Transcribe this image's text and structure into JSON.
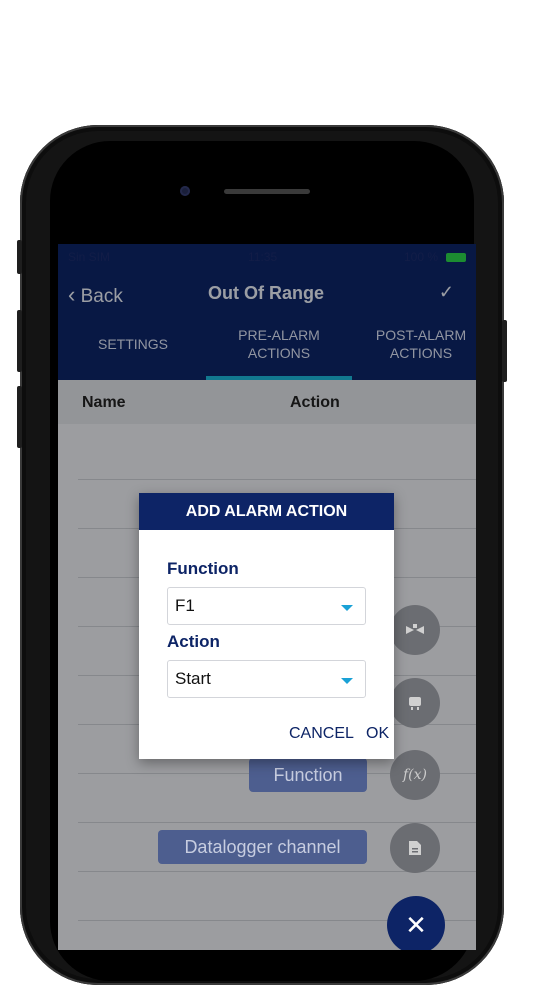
{
  "status_bar": {
    "carrier": "Sin SIM",
    "time": "11:35",
    "battery": "100 %"
  },
  "nav": {
    "back_label": "Back",
    "title": "Out Of Range",
    "confirm_icon": "✓"
  },
  "tabs": [
    {
      "label": "SETTINGS"
    },
    {
      "label": "PRE-ALARM ACTIONS",
      "active": true
    },
    {
      "label": "POST-ALARM ACTIONS"
    }
  ],
  "table": {
    "col_name": "Name",
    "col_action": "Action"
  },
  "fab_menu": {
    "items": [
      {
        "icon": "valve-icon"
      },
      {
        "icon": "device-icon"
      },
      {
        "label": "Function",
        "icon": "function-icon",
        "icon_text": "f(x)"
      },
      {
        "label": "Datalogger channel",
        "icon": "document-icon"
      }
    ],
    "close_icon": "✕"
  },
  "dialog": {
    "title": "ADD ALARM ACTION",
    "function_label": "Function",
    "function_value": "F1",
    "action_label": "Action",
    "action_value": "Start",
    "cancel_label": "CANCEL",
    "ok_label": "OK"
  },
  "colors": {
    "primary": "#0d2466",
    "accent": "#1bb3d6",
    "battery": "#2bd14a"
  }
}
